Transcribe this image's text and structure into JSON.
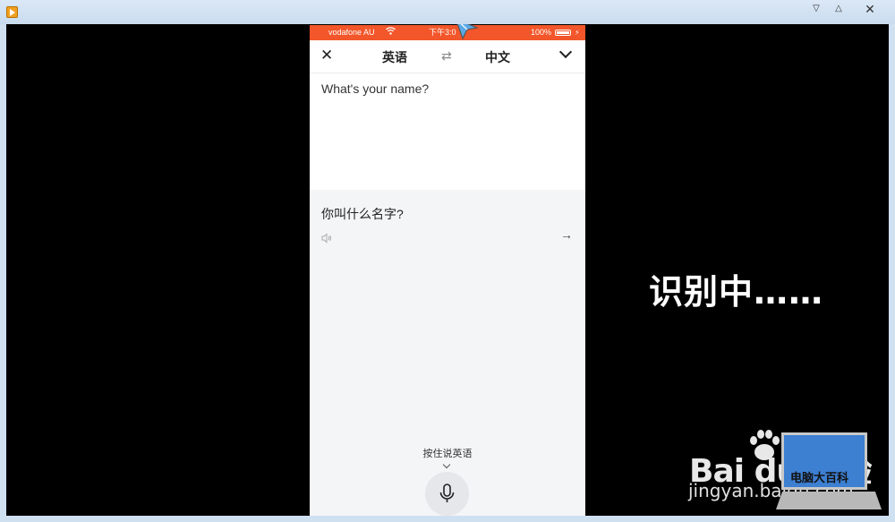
{
  "window": {
    "menu_glyph": "▽",
    "max_glyph": "△",
    "close_glyph": "✕"
  },
  "statusbar": {
    "carrier": "vodafone AU",
    "time": "下午3:0",
    "battery": "100%",
    "bolt": "⚡"
  },
  "header": {
    "close_glyph": "✕",
    "source_lang": "英语",
    "swap_glyph": "⇄",
    "target_lang": "中文"
  },
  "source": {
    "text": "What's your name?"
  },
  "result": {
    "text": "你叫什么名字?",
    "go_glyph": "→"
  },
  "voice": {
    "hint": "按住说英语"
  },
  "overlay": {
    "text": "识别中……"
  },
  "watermark": {
    "logo": "Bai  du 经验",
    "site": "jingyan.baidu.com",
    "laptop_text": "电脑大百科"
  },
  "colors": {
    "accent": "#f2562a",
    "result_bg": "#f4f5f7"
  }
}
